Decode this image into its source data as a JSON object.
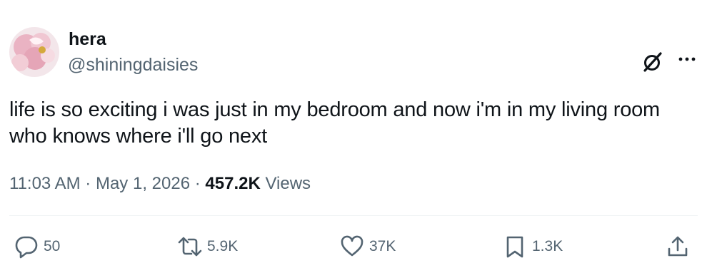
{
  "author": {
    "display_name": "hera",
    "handle": "@shiningdaisies",
    "avatar": "avatar-image"
  },
  "header_icons": [
    "grok-icon",
    "more-icon"
  ],
  "tweet": {
    "text_line1": "life is so exciting i was just in my bedroom and now i'm in my living room",
    "text_line2": "who knows where i'll go next"
  },
  "meta": {
    "time": "11:03 AM",
    "separator": "·",
    "date": "May 1, 2026",
    "views_count": "457.2K",
    "views_label": "Views"
  },
  "actions": {
    "replies": "50",
    "retweets": "5.9K",
    "likes": "37K",
    "bookmarks": "1.3K",
    "icons": [
      "reply-icon",
      "retweet-icon",
      "heart-icon",
      "bookmark-icon",
      "share-icon"
    ]
  },
  "colors": {
    "text": "#0f1419",
    "secondary_text": "#536471",
    "divider": "#eff3f4"
  }
}
